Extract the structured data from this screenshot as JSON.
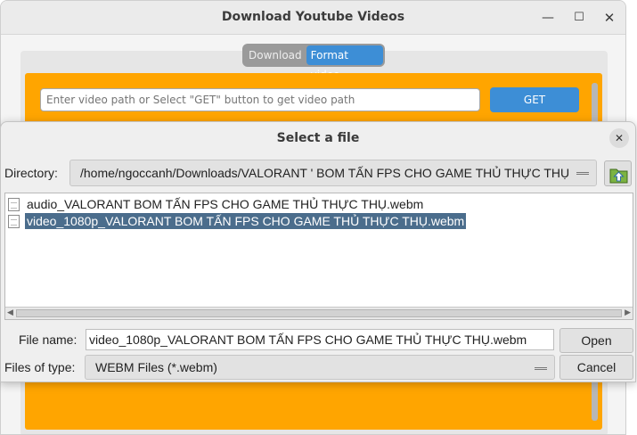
{
  "main_window": {
    "title": "Download Youtube Videos",
    "tabs": [
      {
        "label": "Download",
        "active": false
      },
      {
        "label": "Format video",
        "active": true
      }
    ],
    "path_input_placeholder": "Enter video path or Select \"GET\" button to get video path",
    "get_button_label": "GET",
    "accent_color": "#ffa500",
    "button_color": "#3d8ed6"
  },
  "dialog": {
    "title": "Select a file",
    "directory_label": "Directory:",
    "directory_value": "/home/ngoccanh/Downloads/VALORANT ' BOM TẤN FPS CHO GAME THỦ THỰC THỤ",
    "files": [
      {
        "name": "audio_VALORANT  BOM TẤN FPS CHO GAME THỦ THỰC THỤ.webm",
        "selected": false
      },
      {
        "name": "video_1080p_VALORANT  BOM TẤN FPS CHO GAME THỦ THỰC THỤ.webm",
        "selected": true
      }
    ],
    "file_name_label": "File name:",
    "file_name_value": "video_1080p_VALORANT  BOM TẤN FPS CHO GAME THỦ THỰC THỤ.webm",
    "file_type_label": "Files of type:",
    "file_type_value": "WEBM Files (*.webm)",
    "open_label": "Open",
    "cancel_label": "Cancel",
    "selection_color": "#4b6d8c"
  }
}
